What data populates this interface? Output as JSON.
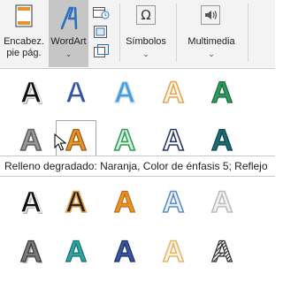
{
  "ribbon": {
    "header_footer_label": "Encabez. pie pág.",
    "wordart_label": "WordArt",
    "symbols_label": "Símbolos",
    "multimedia_label": "Multimedia",
    "chevron": "⌄"
  },
  "tooltip": "Relleno degradado: Naranja, Color de énfasis 5; Reflejo",
  "gallery": {
    "glyph": "A",
    "styles": [
      {
        "fill": "#111111",
        "stroke": "#ffffff",
        "effect": "shadow"
      },
      {
        "fill": "#3a55a0",
        "stroke": "#ffffff",
        "effect": "none"
      },
      {
        "fill": "#4d9bd6",
        "stroke": "#bfe0f7",
        "effect": "none"
      },
      {
        "fill": "#fff7ea",
        "stroke": "#e6a552",
        "effect": "outline"
      },
      {
        "fill": "#2e9a5f",
        "stroke": "#1a6b3e",
        "effect": "none"
      },
      {
        "fill": "#9a9a9a",
        "stroke": "#5f5f5f",
        "effect": "outline"
      },
      {
        "fill": "#e8922a",
        "stroke": "#9a5a10",
        "effect": "reflect"
      },
      {
        "fill": "#d7f0de",
        "stroke": "#2f9e5b",
        "effect": "outline"
      },
      {
        "fill": "#ffffff",
        "stroke": "#2a3a66",
        "effect": "outline"
      },
      {
        "fill": "#1d6b70",
        "stroke": "#0e4448",
        "effect": "none"
      },
      {
        "fill": "#111111",
        "stroke": "#ffffff",
        "effect": "shadow"
      },
      {
        "fill": "#222222",
        "stroke": "#e8a24a",
        "effect": "outline"
      },
      {
        "fill": "#e8922a",
        "stroke": "#c06d10",
        "effect": "none"
      },
      {
        "fill": "#eef4fb",
        "stroke": "#5c8fc6",
        "effect": "outline"
      },
      {
        "fill": "#f2f2f2",
        "stroke": "#bdbdbd",
        "effect": "outline"
      },
      {
        "fill": "#7a7a7a",
        "stroke": "#3a3a3a",
        "effect": "shadow"
      },
      {
        "fill": "#2fa5a0",
        "stroke": "#1a6f6b",
        "effect": "none"
      },
      {
        "fill": "#3a55a0",
        "stroke": "#1f3366",
        "effect": "none"
      },
      {
        "fill": "#fff5e6",
        "stroke": "#e8b46a",
        "effect": "outline"
      },
      {
        "fill": "#ffffff",
        "stroke": "#333333",
        "effect": "hatch"
      }
    ]
  }
}
